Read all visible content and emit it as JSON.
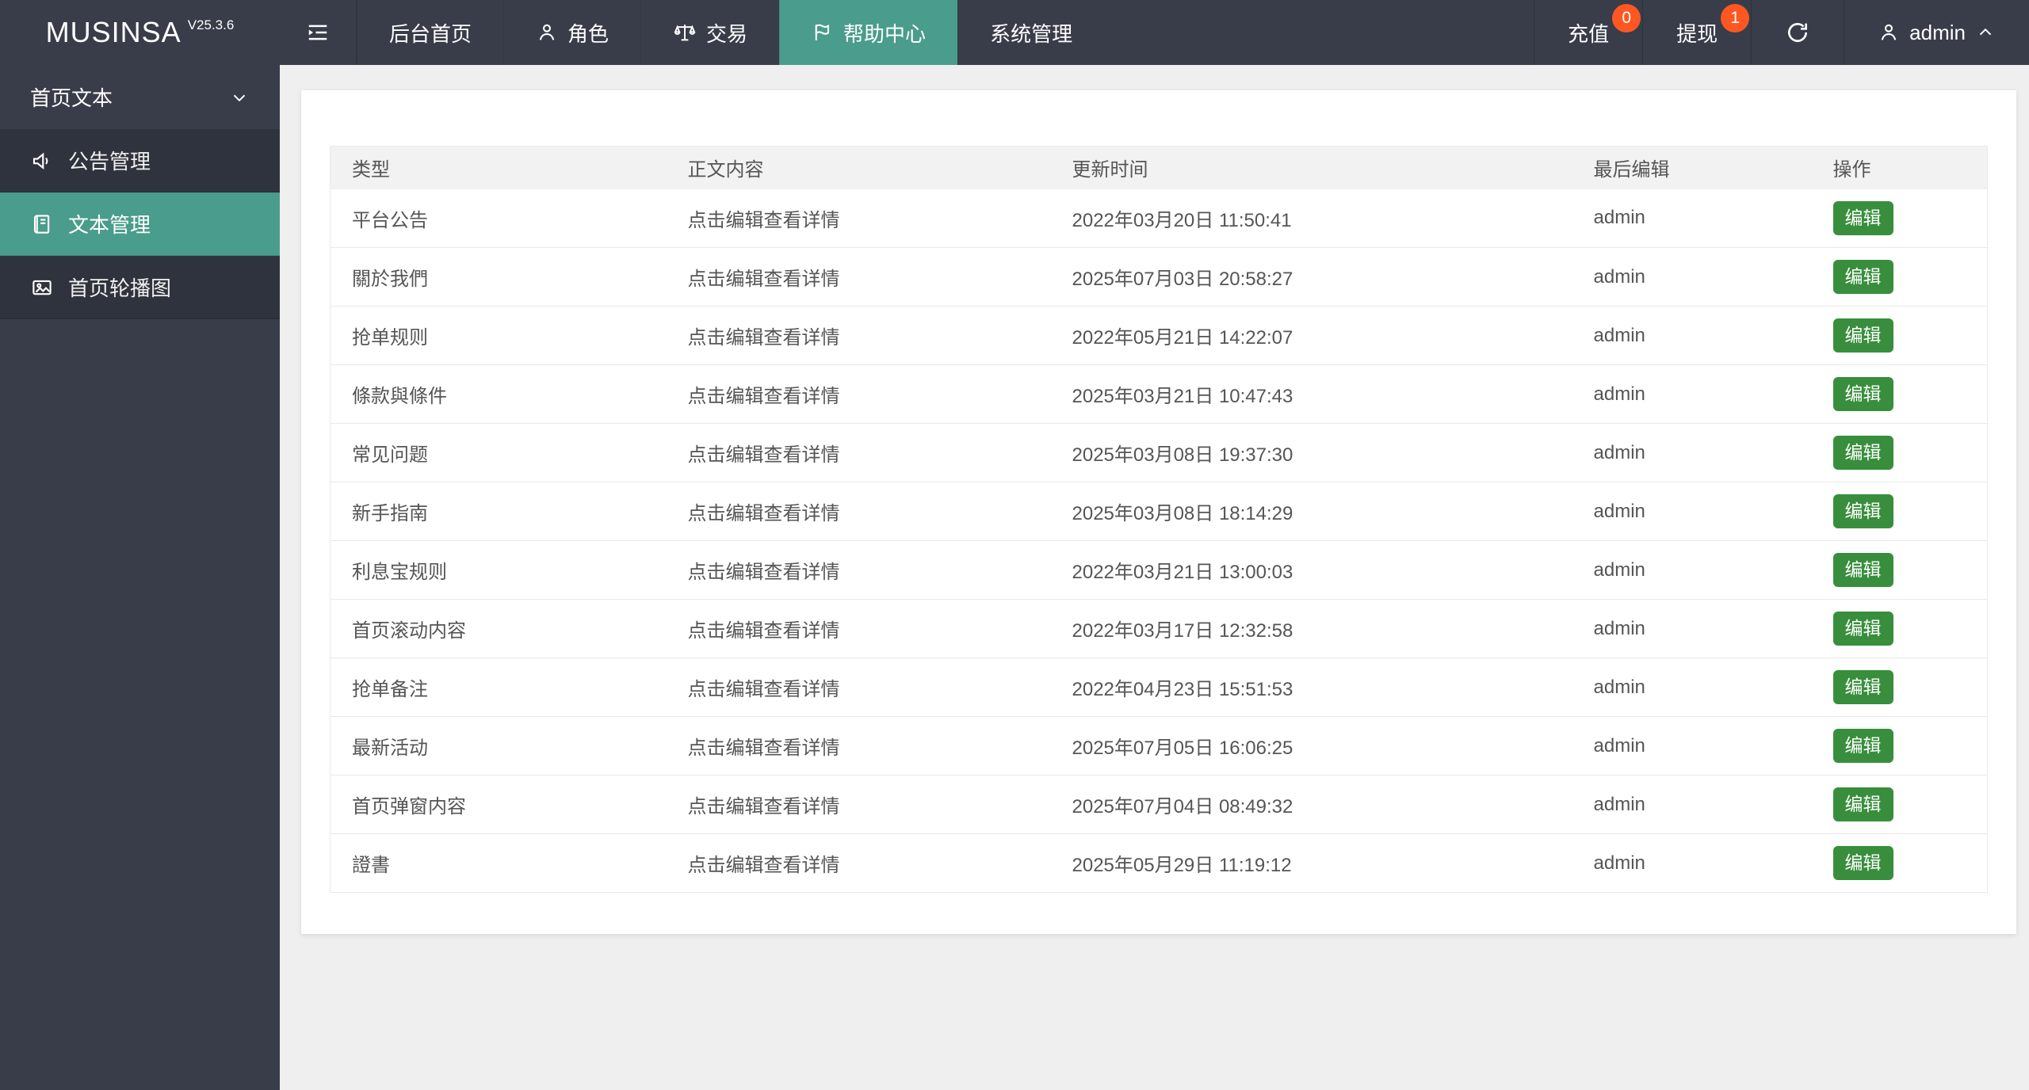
{
  "app": {
    "name": "MUSINSA",
    "version": "V25.3.6"
  },
  "topbar": {
    "nav": [
      {
        "label": "后台首页"
      },
      {
        "label": "角色"
      },
      {
        "label": "交易"
      },
      {
        "label": "帮助中心"
      },
      {
        "label": "系统管理"
      }
    ],
    "recharge": {
      "label": "充值",
      "badge": "0"
    },
    "withdraw": {
      "label": "提现",
      "badge": "1"
    },
    "user": {
      "name": "admin"
    }
  },
  "sidebar": {
    "group_label": "首页文本",
    "items": [
      {
        "label": "公告管理"
      },
      {
        "label": "文本管理"
      },
      {
        "label": "首页轮播图"
      }
    ]
  },
  "table": {
    "columns": [
      "类型",
      "正文内容",
      "更新时间",
      "最后编辑",
      "操作"
    ],
    "edit_label": "编辑",
    "rows": [
      {
        "type": "平台公告",
        "content": "点击编辑查看详情",
        "updated": "2022年03月20日 11:50:41",
        "editor": "admin"
      },
      {
        "type": "關於我們",
        "content": "点击编辑查看详情",
        "updated": "2025年07月03日 20:58:27",
        "editor": "admin"
      },
      {
        "type": "抢单规则",
        "content": "点击编辑查看详情",
        "updated": "2022年05月21日 14:22:07",
        "editor": "admin"
      },
      {
        "type": "條款與條件",
        "content": "点击编辑查看详情",
        "updated": "2025年03月21日 10:47:43",
        "editor": "admin"
      },
      {
        "type": "常见问题",
        "content": "点击编辑查看详情",
        "updated": "2025年03月08日 19:37:30",
        "editor": "admin"
      },
      {
        "type": "新手指南",
        "content": "点击编辑查看详情",
        "updated": "2025年03月08日 18:14:29",
        "editor": "admin"
      },
      {
        "type": "利息宝规则",
        "content": "点击编辑查看详情",
        "updated": "2022年03月21日 13:00:03",
        "editor": "admin"
      },
      {
        "type": "首页滚动内容",
        "content": "点击编辑查看详情",
        "updated": "2022年03月17日 12:32:58",
        "editor": "admin"
      },
      {
        "type": "抢单备注",
        "content": "点击编辑查看详情",
        "updated": "2022年04月23日 15:51:53",
        "editor": "admin"
      },
      {
        "type": "最新活动",
        "content": "点击编辑查看详情",
        "updated": "2025年07月05日 16:06:25",
        "editor": "admin"
      },
      {
        "type": "首页弹窗内容",
        "content": "点击编辑查看详情",
        "updated": "2025年07月04日 08:49:32",
        "editor": "admin"
      },
      {
        "type": "證書",
        "content": "点击编辑查看详情",
        "updated": "2025年05月29日 11:19:12",
        "editor": "admin"
      }
    ]
  },
  "colors": {
    "topbar_bg": "#393D49",
    "sidebar_item_bg": "#2F333D",
    "accent_teal": "#4A9C8C",
    "badge_orange": "#FF5722",
    "edit_green": "#388E3C",
    "page_bg": "#EFEFEF",
    "table_header_bg": "#F2F2F2"
  }
}
